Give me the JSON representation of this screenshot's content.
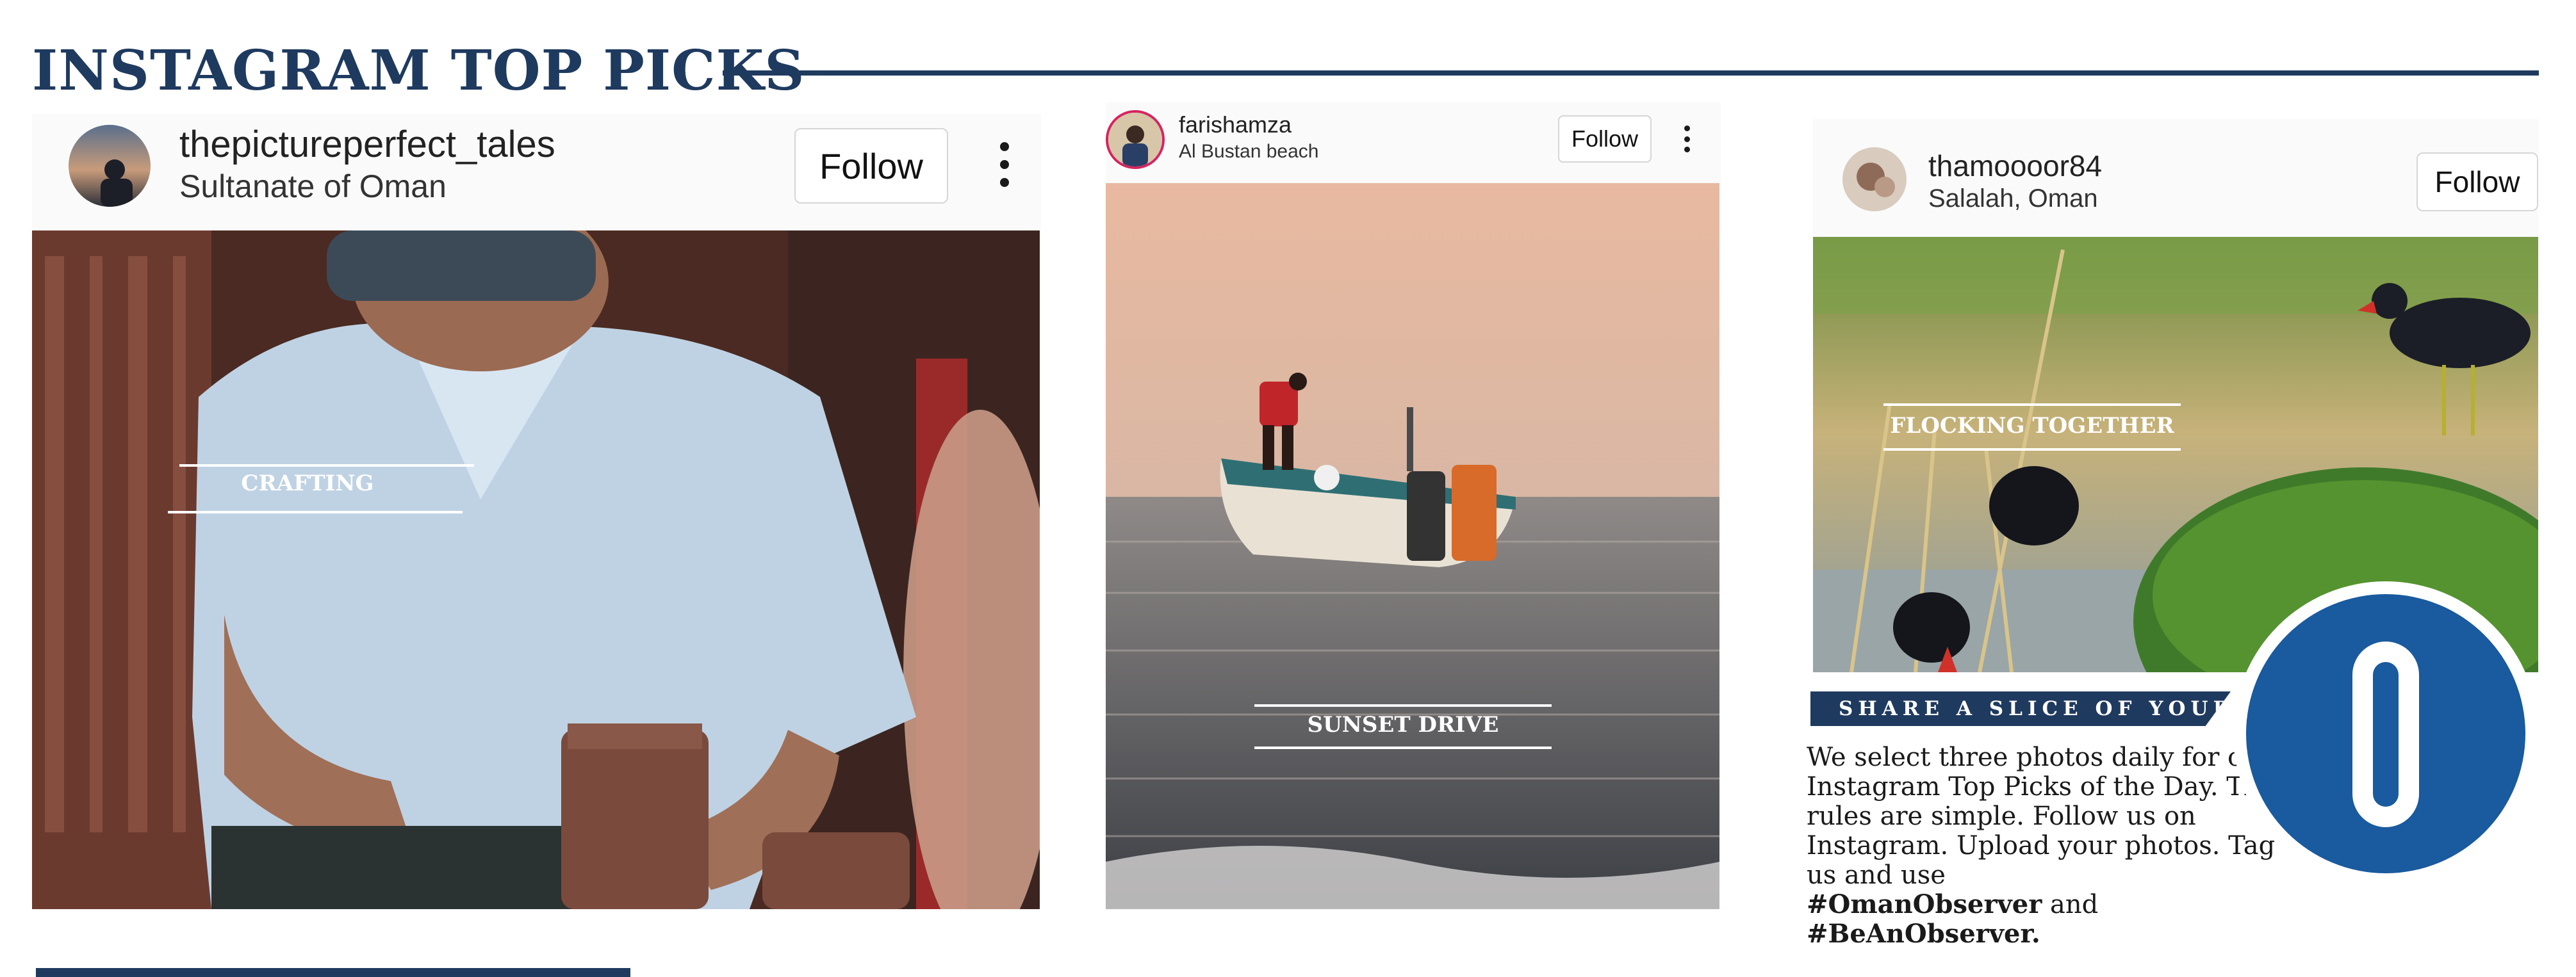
{
  "page": {
    "title": "INSTAGRAM TOP PICKS",
    "accent_color": "#1f3a5f"
  },
  "posts": [
    {
      "username": "thepictureperfect_tales",
      "location": "Sultanate of Oman",
      "follow_label": "Follow",
      "caption": "CRAFTING",
      "has_more_menu": true
    },
    {
      "username": "farishamza",
      "location": "Al Bustan beach",
      "follow_label": "Follow",
      "caption": "SUNSET DRIVE",
      "has_more_menu": true
    },
    {
      "username": "thamoooor84",
      "location": "Salalah, Oman",
      "follow_label": "Follow",
      "caption": "FLOCKING TOGETHER",
      "has_more_menu": false
    }
  ],
  "promo": {
    "banner": "SHARE A SLICE OF YOUR LIFE",
    "text": "We select three photos daily for our Instagram Top Picks of the Day. The rules are simple. Follow us on Instagram. Upload your photos. Tag us and use",
    "hashtag_1": "#OmanObserver",
    "joiner": "and",
    "hashtag_2": "#BeAnObserver.",
    "logo_letter": "O",
    "logo_color": "#1a5a9e"
  }
}
